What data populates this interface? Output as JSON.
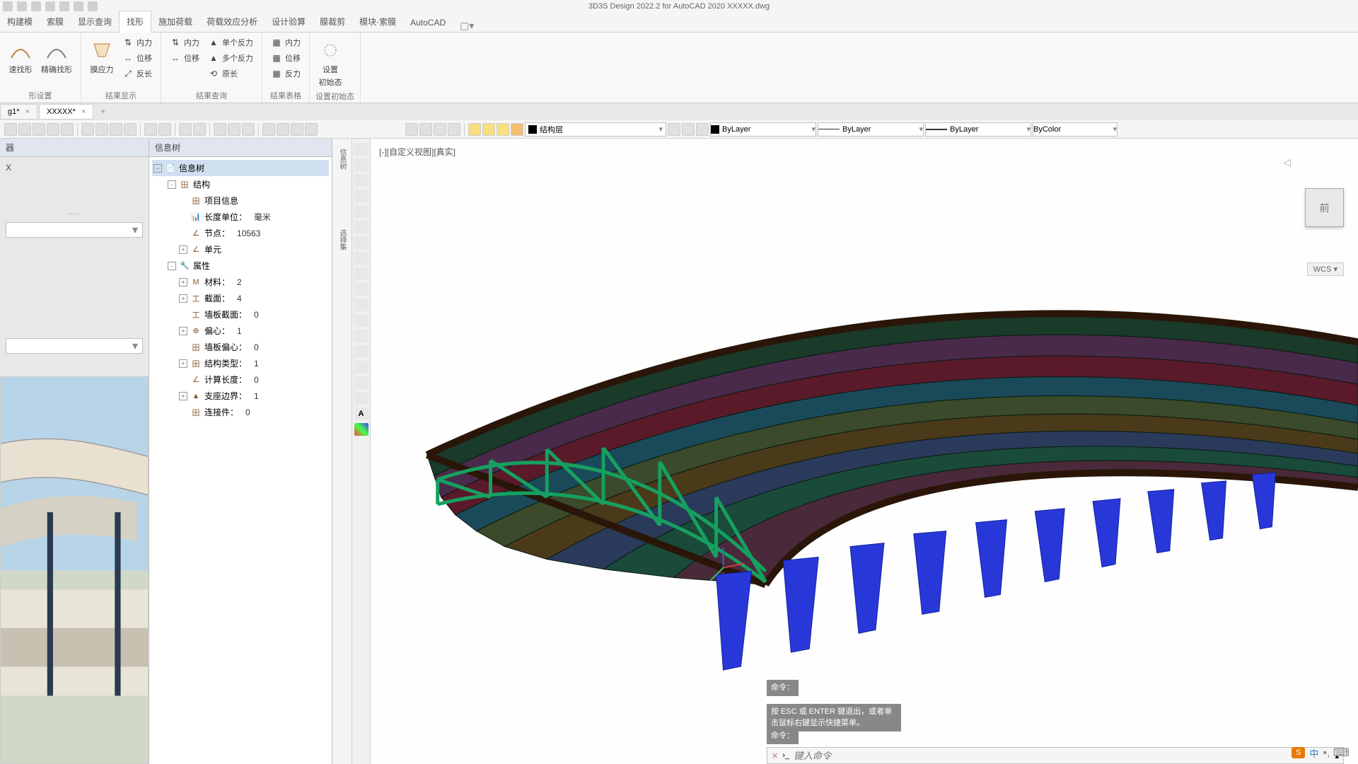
{
  "title": "3D3S Design 2022.2 for AutoCAD 2020    XXXXX.dwg",
  "ribbon_tabs": {
    "items": [
      "构建模",
      "索膜",
      "显示查询",
      "找形",
      "施加荷载",
      "荷载效应分析",
      "设计验算",
      "膜裁剪",
      "模块·索膜",
      "AutoCAD"
    ],
    "active_index": 3
  },
  "ribbon_groups": {
    "g0": {
      "big": [
        {
          "label": "速找形",
          "svg_arc": true
        },
        {
          "label": "精确找形",
          "svg_arc": true
        }
      ],
      "title": "形设置"
    },
    "g1": {
      "big": {
        "label": "膜应力"
      },
      "small": [
        "内力",
        "位移",
        "反长"
      ],
      "title": "结果显示"
    },
    "g2": {
      "small_l": [
        "内力",
        "位移"
      ],
      "small_r": [
        "单个反力",
        "多个反力",
        "原长"
      ],
      "title": "结果查询"
    },
    "g3": {
      "small": [
        "内力",
        "位移",
        "反力"
      ],
      "title": "结果表格"
    },
    "g4": {
      "big": {
        "label1": "设置",
        "label2": "初始态"
      },
      "title": "设置初始态"
    }
  },
  "doctabs": {
    "items": [
      {
        "label": "g1*"
      },
      {
        "label": "XXXXX*"
      }
    ],
    "active_index": 1
  },
  "layer_row": {
    "layer": "结构层",
    "colorprop": "ByLayer",
    "lineprop": "ByLayer",
    "weightprop": "ByLayer",
    "plotprop": "ByColor"
  },
  "left_panel": {
    "title": "器",
    "x_label": "X",
    "dots": "....."
  },
  "tree": {
    "title": "信息树",
    "root": "信息树",
    "nodes": [
      {
        "indent": 1,
        "exp": "-",
        "icon": "田",
        "label": "结构"
      },
      {
        "indent": 2,
        "exp": "",
        "icon": "田",
        "label": "项目信息"
      },
      {
        "indent": 2,
        "exp": "",
        "icon": "📊",
        "label": "长度单位：",
        "val": "毫米"
      },
      {
        "indent": 2,
        "exp": "",
        "icon": "∠",
        "label": "节点：",
        "val": "10563"
      },
      {
        "indent": 2,
        "exp": "+",
        "icon": "∠",
        "label": "单元"
      },
      {
        "indent": 1,
        "exp": "-",
        "icon": "🔧",
        "label": "属性"
      },
      {
        "indent": 2,
        "exp": "+",
        "icon": "M",
        "label": "材料：",
        "val": "2"
      },
      {
        "indent": 2,
        "exp": "+",
        "icon": "工",
        "label": "截面：",
        "val": "4"
      },
      {
        "indent": 2,
        "exp": "",
        "icon": "工",
        "label": "墙板截面：",
        "val": "0"
      },
      {
        "indent": 2,
        "exp": "+",
        "icon": "⊕",
        "label": "偏心：",
        "val": "1"
      },
      {
        "indent": 2,
        "exp": "",
        "icon": "田",
        "label": "墙板偏心：",
        "val": "0"
      },
      {
        "indent": 2,
        "exp": "+",
        "icon": "田",
        "label": "结构类型：",
        "val": "1"
      },
      {
        "indent": 2,
        "exp": "",
        "icon": "∠",
        "label": "计算长度：",
        "val": "0"
      },
      {
        "indent": 2,
        "exp": "+",
        "icon": "▲",
        "label": "支座边界：",
        "val": "1"
      },
      {
        "indent": 2,
        "exp": "",
        "icon": "田",
        "label": "连接件：",
        "val": "0"
      }
    ]
  },
  "vstrip_labels": {
    "l1": "信息树",
    "l2": "选择集"
  },
  "viewport": {
    "label": "[-][自定义视图][真实]",
    "viewcube": "前",
    "wcs": "WCS"
  },
  "cmd": {
    "prompt1": "命令：",
    "tip": "按 ESC 或 ENTER 键退出，或者单击鼠标右键显示快捷菜单。",
    "prompt2": "命令：",
    "placeholder": "键入命令"
  },
  "ime": {
    "badge": "S",
    "lang": "中"
  }
}
